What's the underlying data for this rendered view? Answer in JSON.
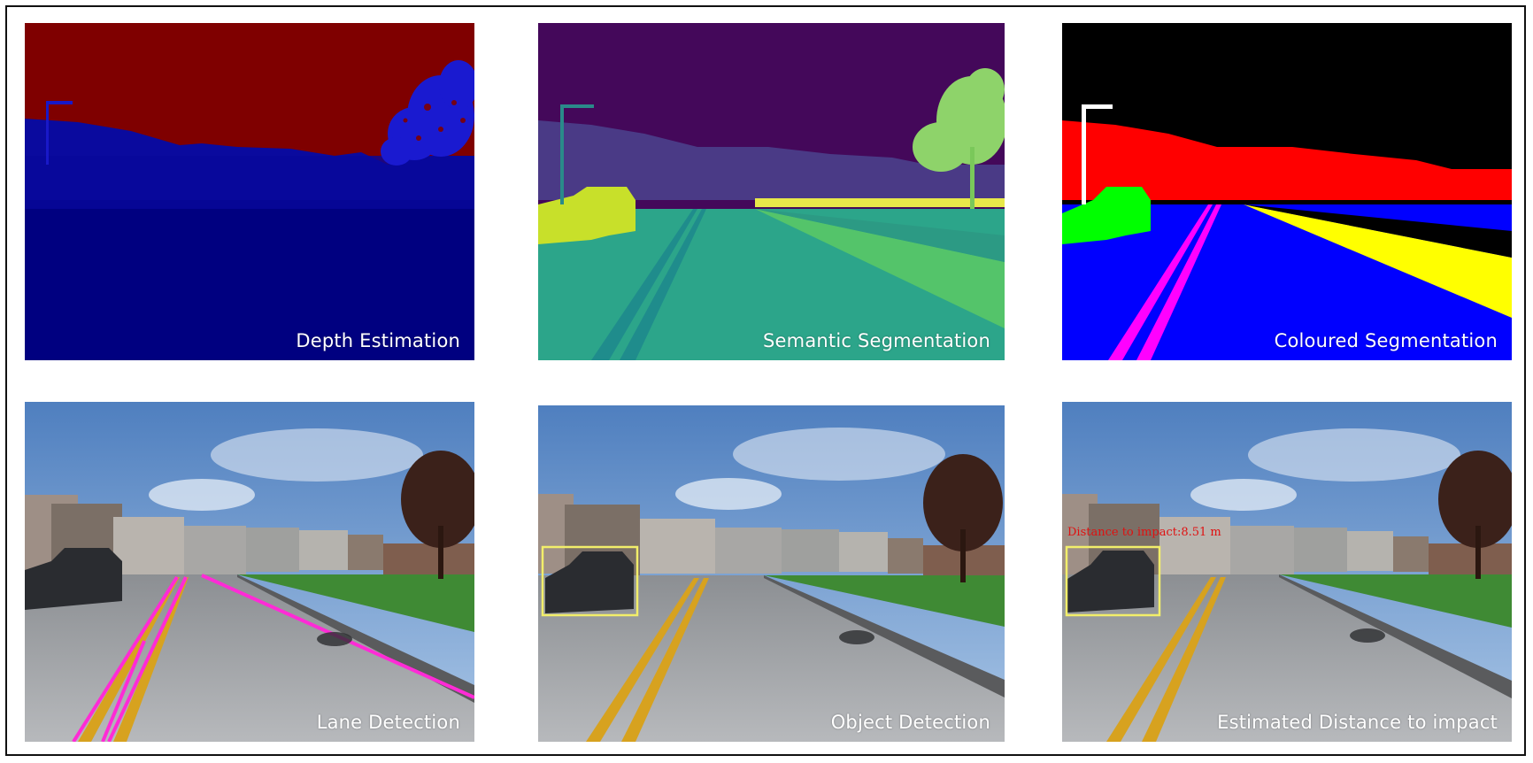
{
  "panels": {
    "depth": {
      "caption": "Depth Estimation"
    },
    "semantic": {
      "caption": "Semantic Segmentation"
    },
    "coloured": {
      "caption": "Coloured Segmentation"
    },
    "lane": {
      "caption": "Lane Detection"
    },
    "object": {
      "caption": "Object Detection"
    },
    "distance": {
      "caption": "Estimated Distance to impact",
      "overlay_text": "Distance to impact:8.51 m"
    }
  },
  "colors": {
    "depth_sky": "#7f0000",
    "depth_ground": "#00007f",
    "lane_line": "#ff2bd6",
    "bbox": "#f2ee6a",
    "distance_text": "#e01010",
    "seg_road": "#0000ff",
    "seg_sidewalk": "#ffff00",
    "seg_building": "#ff0000",
    "seg_vehicle": "#00ff00",
    "seg_roadline": "#ff00ff"
  }
}
